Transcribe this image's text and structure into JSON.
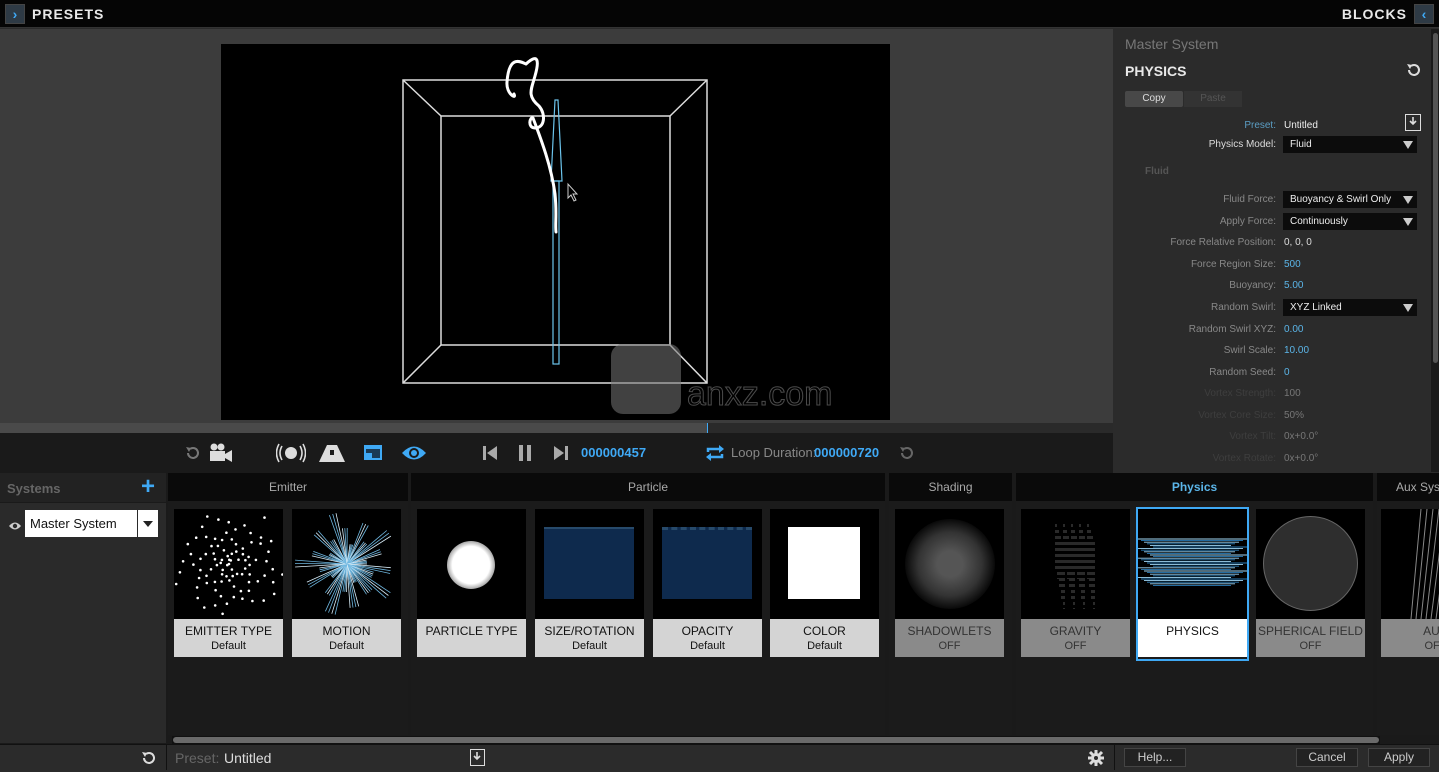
{
  "topbar": {
    "left_button_icon": "chevron-right-icon",
    "left_title": "PRESETS",
    "right_title": "BLOCKS",
    "right_button_icon": "chevron-left-icon"
  },
  "transport": {
    "icons": [
      "undo-icon",
      "camera-icon",
      "motion-blur-icon",
      "road-icon",
      "display-icon",
      "eye-icon",
      "skip-start-icon",
      "pause-icon",
      "skip-end-icon",
      "loop-icon",
      "reset-icon"
    ],
    "current_frame": "000000457",
    "loop_label": "Loop Duration:",
    "loop_duration": "000000720",
    "progress": 0.635
  },
  "panel": {
    "system_name": "Master System",
    "title": "PHYSICS",
    "copy_label": "Copy",
    "paste_label": "Paste",
    "preset_label": "Preset:",
    "preset_value": "Untitled",
    "physics_model_label": "Physics Model:",
    "physics_model_value": "Fluid",
    "section": "Fluid",
    "rows": [
      {
        "label": "Fluid Force:",
        "value": "Buoyancy & Swirl Only",
        "type": "select"
      },
      {
        "label": "Apply Force:",
        "value": "Continuously",
        "type": "select"
      },
      {
        "label": "Force Relative Position:",
        "value": "0, 0, 0",
        "type": "text"
      },
      {
        "label": "Force Region Size:",
        "value": "500",
        "type": "blue"
      },
      {
        "label": "Buoyancy:",
        "value": "5.00",
        "type": "blue"
      },
      {
        "label": "Random Swirl:",
        "value": "XYZ Linked",
        "type": "select"
      },
      {
        "label": "Random Swirl XYZ:",
        "value": "0.00",
        "type": "blue"
      },
      {
        "label": "Swirl Scale:",
        "value": "10.00",
        "type": "blue"
      },
      {
        "label": "Random Seed:",
        "value": "0",
        "type": "blue"
      },
      {
        "label": "Vortex Strength:",
        "value": "100",
        "type": "dim"
      },
      {
        "label": "Vortex Core Size:",
        "value": "50%",
        "type": "dim"
      },
      {
        "label": "Vortex Tilt:",
        "value": "0x+0.0°",
        "type": "dim"
      },
      {
        "label": "Vortex Rotate:",
        "value": "0x+0.0°",
        "type": "dim"
      }
    ]
  },
  "systems": {
    "header": "Systems",
    "add_icon": "plus-icon",
    "items": [
      {
        "name": "Master System",
        "visible": true
      }
    ]
  },
  "groups": [
    {
      "name": "Emitter",
      "active": false
    },
    {
      "name": "Particle",
      "active": false
    },
    {
      "name": "Shading",
      "active": false
    },
    {
      "name": "Physics",
      "active": true
    },
    {
      "name": "Aux System",
      "active": false
    }
  ],
  "tiles": [
    {
      "title": "EMITTER TYPE",
      "sub": "Default",
      "state": "on"
    },
    {
      "title": "MOTION",
      "sub": "Default",
      "state": "on"
    },
    {
      "title": "PARTICLE TYPE",
      "sub": "",
      "state": "on"
    },
    {
      "title": "SIZE/ROTATION",
      "sub": "Default",
      "state": "on"
    },
    {
      "title": "OPACITY",
      "sub": "Default",
      "state": "on"
    },
    {
      "title": "COLOR",
      "sub": "Default",
      "state": "on"
    },
    {
      "title": "SHADOWLETS",
      "sub": "OFF",
      "state": "off"
    },
    {
      "title": "GRAVITY",
      "sub": "OFF",
      "state": "off"
    },
    {
      "title": "PHYSICS",
      "sub": "",
      "state": "selected"
    },
    {
      "title": "SPHERICAL FIELD",
      "sub": "OFF",
      "state": "off"
    },
    {
      "title": "AUX",
      "sub": "OFF",
      "state": "off"
    }
  ],
  "footer": {
    "preset_label": "Preset:",
    "preset_value": "Untitled",
    "help_label": "Help...",
    "cancel_label": "Cancel",
    "apply_label": "Apply"
  },
  "watermark": "anxz.com",
  "colors": {
    "accent": "#3fa9f5"
  }
}
